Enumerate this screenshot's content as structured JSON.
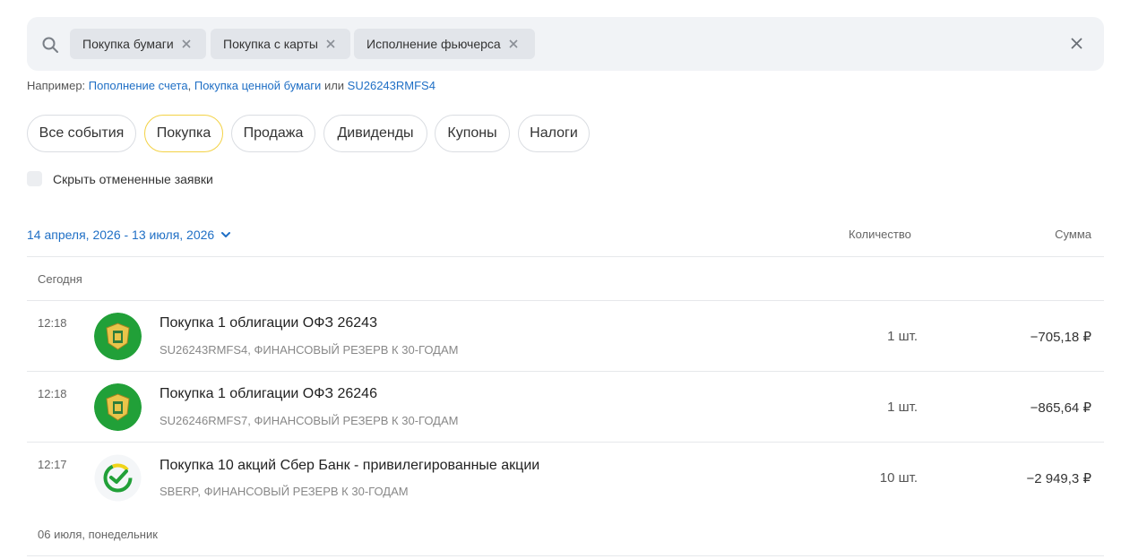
{
  "search": {
    "chips": [
      {
        "label": "Покупка бумаги"
      },
      {
        "label": "Покупка с карты"
      },
      {
        "label": "Исполнение фьючерса"
      }
    ]
  },
  "hint": {
    "prefix": "Например:",
    "link1": "Пополнение счета",
    "sep": ",",
    "link2": "Покупка ценной бумаги",
    "or": "или",
    "link3": "SU26243RMFS4"
  },
  "filters": [
    {
      "label": "Все события",
      "active": false
    },
    {
      "label": "Покупка",
      "active": true
    },
    {
      "label": "Продажа",
      "active": false
    },
    {
      "label": "Дивиденды",
      "active": false
    },
    {
      "label": "Купоны",
      "active": false
    },
    {
      "label": "Налоги",
      "active": false
    }
  ],
  "hide_cancelled": {
    "label": "Скрыть отмененные заявки",
    "checked": false
  },
  "table": {
    "date_range": "14 апреля, 2026 - 13 июля, 2026",
    "col_quantity": "Количество",
    "col_sum": "Сумма"
  },
  "groups": [
    {
      "day": "Сегодня",
      "operations": [
        {
          "time": "12:18",
          "title": "Покупка 1 облигации ОФЗ 26243",
          "subtitle": "SU26243RMFS4, ФИНАНСОВЫЙ РЕЗЕРВ К 30-ГОДАМ",
          "quantity": "1 шт.",
          "sum": "−705,18 ₽",
          "logo": "ofz-emblem-icon"
        },
        {
          "time": "12:18",
          "title": "Покупка 1 облигации ОФЗ 26246",
          "subtitle": "SU26246RMFS7, ФИНАНСОВЫЙ РЕЗЕРВ К 30-ГОДАМ",
          "quantity": "1 шт.",
          "sum": "−865,64 ₽",
          "logo": "ofz-emblem-icon"
        },
        {
          "time": "12:17",
          "title": "Покупка 10 акций Сбер Банк - привилегированные акции",
          "subtitle": "SBERP, ФИНАНСОВЫЙ РЕЗЕРВ К 30-ГОДАМ",
          "quantity": "10 шт.",
          "sum": "−2 949,3 ₽",
          "logo": "sber-logo-icon"
        }
      ]
    },
    {
      "day": "06 июля, понедельник",
      "operations": []
    }
  ],
  "colors": {
    "link": "#1f6fc5",
    "active_pill_border": "#f3d245",
    "ofz_green": "#21a038"
  }
}
